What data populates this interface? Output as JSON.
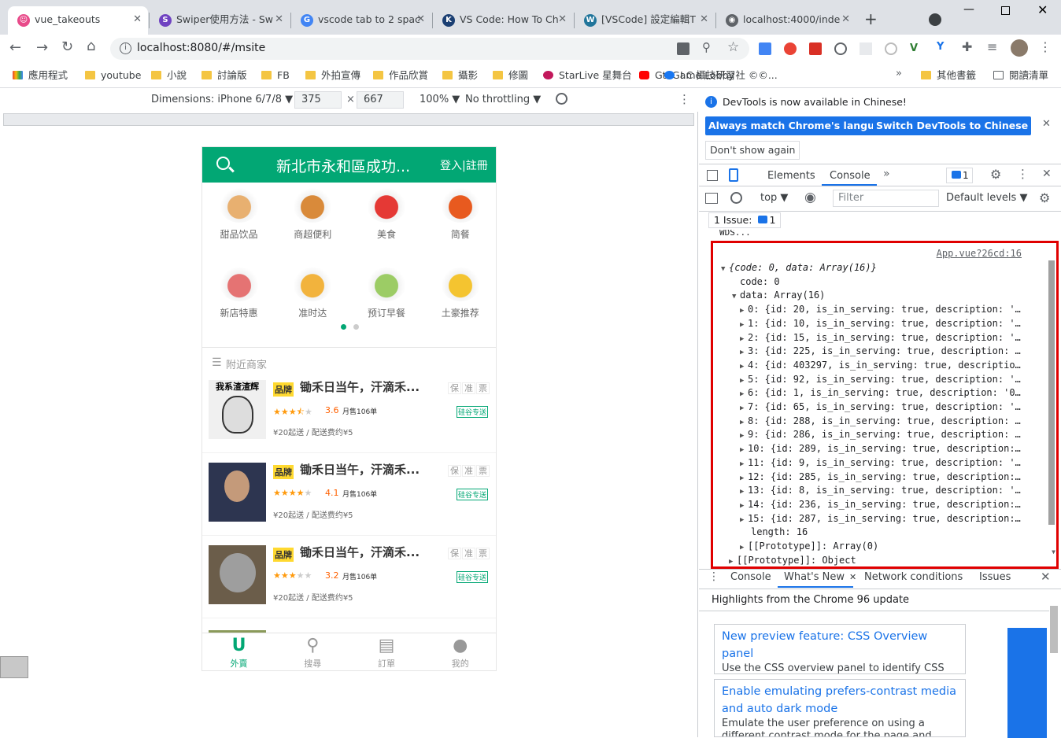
{
  "tabs": [
    {
      "title": "vue_takeouts",
      "active": true,
      "fav_color": "#e84b8a",
      "fav": "☺"
    },
    {
      "title": "Swiper使用方法 - Sw",
      "active": false,
      "fav_color": "#6f42c1",
      "fav": "S"
    },
    {
      "title": "vscode tab to 2 spac",
      "active": false,
      "fav_color": "#4285f4",
      "fav": "G"
    },
    {
      "title": "VS Code: How To Ch",
      "active": false,
      "fav_color": "#1b3f73",
      "fav": "K"
    },
    {
      "title": "[VSCode] 設定編輯T",
      "active": false,
      "fav_color": "#21759b",
      "fav": "W"
    },
    {
      "title": "localhost:4000/inde",
      "active": false,
      "fav_color": "#5f6368",
      "fav": "◉"
    }
  ],
  "omnibox": {
    "url": "localhost:8080/#/msite"
  },
  "bookmarks": [
    "應用程式",
    "youtube",
    "小說",
    "討論版",
    "FB",
    "外拍宣傳",
    "作品欣賞",
    "攝影",
    "修圖",
    "StarLive 星舞台",
    "Gti Game Lobby",
    "I.C 攝技研習社 ©©...",
    "其他書籤",
    "閱讀清單"
  ],
  "device": {
    "dimensions_label": "Dimensions: iPhone 6/7/8 ▼",
    "width": "375",
    "height": "667",
    "zoom": "100% ▼",
    "throttle": "No throttling ▼"
  },
  "phone": {
    "header_title": "新北市永和區成功...",
    "login": "登入|註冊",
    "categories": [
      "甜品饮品",
      "商超便利",
      "美食",
      "简餐",
      "新店特惠",
      "准时达",
      "预订早餐",
      "土豪推荐"
    ],
    "nearby": "附近商家",
    "shops": [
      {
        "brand": "品牌",
        "title": "锄禾日当午，汗滴禾...",
        "badges": [
          "保",
          "准",
          "票"
        ],
        "stars_on": 3,
        "half": true,
        "rating": "3.6",
        "sales": "月售106单",
        "fast": "硅谷专送",
        "fee": "¥20起送 / 配送费约¥5"
      },
      {
        "brand": "品牌",
        "title": "锄禾日当午，汗滴禾...",
        "badges": [
          "保",
          "准",
          "票"
        ],
        "stars_on": 4,
        "half": false,
        "rating": "4.1",
        "sales": "月售106单",
        "fast": "硅谷专送",
        "fee": "¥20起送 / 配送费约¥5"
      },
      {
        "brand": "品牌",
        "title": "锄禾日当午，汗滴禾...",
        "badges": [
          "保",
          "准",
          "票"
        ],
        "stars_on": 3,
        "half": false,
        "rating": "3.2",
        "sales": "月售106单",
        "fast": "硅谷专送",
        "fee": "¥20起送 / 配送费约¥5"
      }
    ],
    "shop1_img_text": "我系渣渣辉",
    "footer": [
      "外賣",
      "搜尋",
      "訂單",
      "我的"
    ]
  },
  "devtools": {
    "info": "DevTools is now available in Chinese!",
    "btn1": "Always match Chrome's language",
    "btn2": "Switch DevTools to Chinese",
    "dont_show": "Don't show again",
    "panels": [
      "Elements",
      "Console"
    ],
    "issue_count": "1",
    "context": "top ▼",
    "filter_placeholder": "Filter",
    "levels": "Default levels ▼",
    "issues_label": "1 Issue:",
    "wds": "WDS...",
    "source_link": "App.vue?26cd:16",
    "log": [
      "{code: 0, data: Array(16)}",
      "code: 0",
      "data: Array(16)",
      "0: {id: 20, is_in_serving: true, description: '…",
      "1: {id: 10, is_in_serving: true, description: '…",
      "2: {id: 15, is_in_serving: true, description: '…",
      "3: {id: 225, is_in_serving: true, description: …",
      "4: {id: 403297, is_in_serving: true, descriptio…",
      "5: {id: 92, is_in_serving: true, description: '…",
      "6: {id: 1, is_in_serving: true, description: '0…",
      "7: {id: 65, is_in_serving: true, description: '…",
      "8: {id: 288, is_in_serving: true, description: …",
      "9: {id: 286, is_in_serving: true, description: …",
      "10: {id: 289, is_in_serving: true, description:…",
      "11: {id: 9, is_in_serving: true, description: '…",
      "12: {id: 285, is_in_serving: true, description:…",
      "13: {id: 8, is_in_serving: true, description: '…",
      "14: {id: 236, is_in_serving: true, description:…",
      "15: {id: 287, is_in_serving: true, description:…",
      "length: 16",
      "[[Prototype]]: Array(0)",
      "[[Prototype]]: Object"
    ],
    "drawer_tabs": [
      "Console",
      "What's New",
      "Network conditions",
      "Issues"
    ],
    "highlights": "Highlights from the Chrome 96 update",
    "cards": [
      {
        "title": "New preview feature: CSS Overview panel",
        "desc": "Use the CSS overview panel to identify CSS improvements on your page."
      },
      {
        "title": "Enable emulating prefers-contrast media and auto dark mode",
        "desc": "Emulate the user preference on using a different contrast mode for the page and"
      }
    ]
  }
}
